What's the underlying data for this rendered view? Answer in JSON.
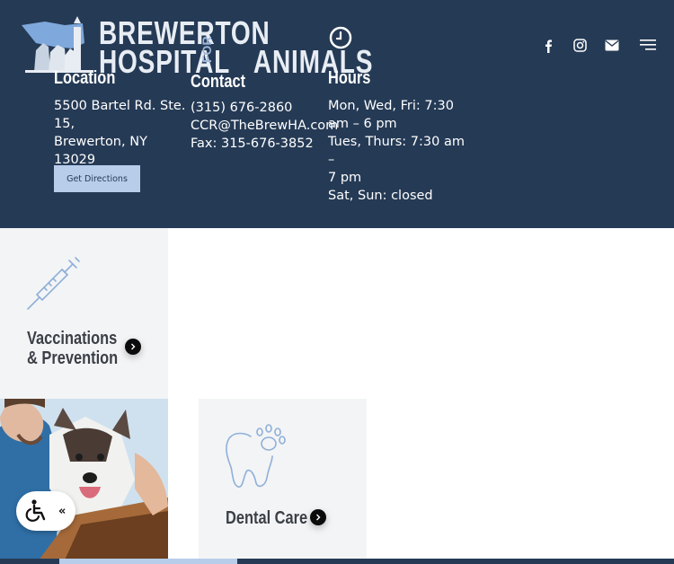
{
  "logo": {
    "line1": "BREWERTON",
    "line2": "HOSPITAL",
    "line2b": "ANIMALS",
    "for": "FOR"
  },
  "location": {
    "heading": "Location",
    "lines": [
      "5500 Bartel Rd. Ste.",
      "15,",
      "Brewerton, NY 13029"
    ],
    "button": "Get Directions"
  },
  "contact": {
    "heading": "Contact",
    "phone": "(315) 676-2860",
    "email": "CCR@TheBrewHA.com",
    "fax": "Fax: 315-676-3852"
  },
  "hours": {
    "heading": "Hours",
    "lines": [
      "Mon, Wed, Fri: 7:30",
      "am – 6 pm",
      "Tues, Thurs: 7:30 am –",
      "7 pm",
      "Sat, Sun: closed"
    ]
  },
  "icons": {
    "clock": "clock-icon",
    "facebook": "facebook-icon",
    "instagram": "instagram-icon",
    "mail": "mail-icon",
    "menu": "menu-icon",
    "syringe": "syringe-icon",
    "tooth": "tooth-paw-icon",
    "wheelchair": "wheelchair-icon"
  },
  "services": {
    "vaccinations": {
      "line1": "Vaccinations",
      "line2": "& Prevention"
    },
    "dental": {
      "title": "Dental Care"
    }
  },
  "accessibility": {
    "chevron": "«"
  },
  "colors": {
    "header_bg": "#253a55",
    "button_bg": "#b7cde9",
    "card_bg": "#f3f4f6",
    "icon_line": "#8fb0d8"
  }
}
